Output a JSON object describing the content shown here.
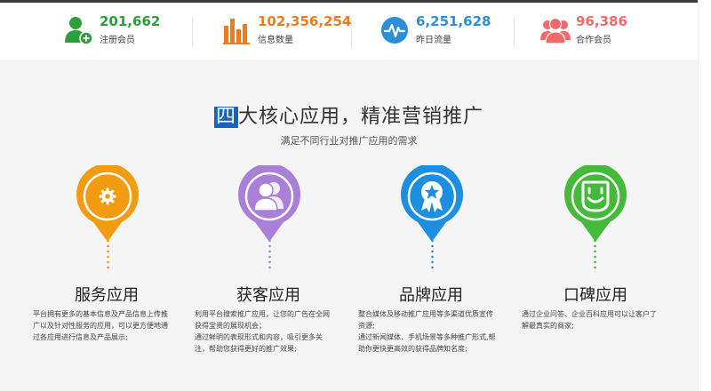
{
  "stats": [
    {
      "value": "201,662",
      "label": "注册会员",
      "color": "#2e9e3a",
      "icon": "add-user-icon"
    },
    {
      "value": "102,356,254",
      "label": "信息数量",
      "color": "#f07b1e",
      "icon": "bar-chart-icon"
    },
    {
      "value": "6,251,628",
      "label": "昨日流量",
      "color": "#2b8fd8",
      "icon": "pulse-icon"
    },
    {
      "value": "96,386",
      "label": "合作会员",
      "color": "#f06a6a",
      "icon": "group-icon"
    }
  ],
  "heading": {
    "highlight": "四",
    "rest": "大核心应用，精准营销推广"
  },
  "subheading": "满足不同行业对推广应用的需求",
  "features": [
    {
      "title": "服务应用",
      "color": "#f39c12",
      "icon": "gear-icon",
      "desc": [
        "平台拥有更多的基本信息及产品信息上传推",
        "广以及针对性服务的应用，可以更方便地通",
        "过各应用进行信息及产品展示;"
      ]
    },
    {
      "title": "获客应用",
      "color": "#a97fd9",
      "icon": "users-icon",
      "desc": [
        "利用平台搜索推广应用，让您的广告在全网",
        "获得宝贵的展现机会；",
        "通过鲜明的表现形式和内容，吸引更多关",
        "注，帮助您获得更好的推广效果;"
      ]
    },
    {
      "title": "品牌应用",
      "color": "#1e8fe0",
      "icon": "badge-star-icon",
      "desc": [
        "整合媒体及移动推广应用等多渠道优质宣传",
        "资源;",
        "通过新闻媒体、手机场景等多种推广形式,帮",
        "助你更快更高效的获得品牌知名度;"
      ]
    },
    {
      "title": "口碑应用",
      "color": "#45b93a",
      "icon": "smile-icon",
      "desc": [
        "通过企业问答、企业百科应用可以让客户了",
        "解最真实的商家;"
      ]
    }
  ]
}
